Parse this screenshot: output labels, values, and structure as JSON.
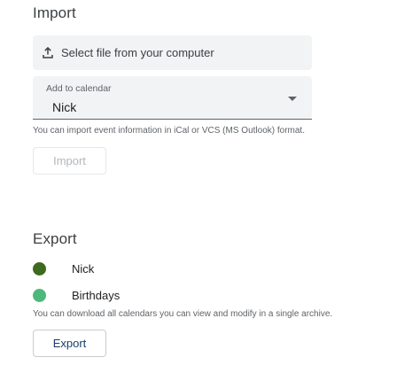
{
  "import": {
    "title": "Import",
    "select_file": {
      "label": "Select file from your computer",
      "icon": "upload-icon"
    },
    "calendar_select": {
      "caption": "Add to calendar",
      "value": "Nick",
      "icon": "dropdown-arrow-icon"
    },
    "help_text": "You can import event information in iCal or VCS (MS Outlook) format.",
    "button_label": "Import"
  },
  "export": {
    "title": "Export",
    "calendars": [
      {
        "name": "Nick",
        "color": "#3d6a1f"
      },
      {
        "name": "Birthdays",
        "color": "#4cb97b"
      }
    ],
    "help_text": "You can download all calendars you can view and modify in a single archive.",
    "button_label": "Export"
  },
  "colors": {
    "panel_background": "#f1f3f4",
    "text_primary": "#202124",
    "text_secondary": "#5f6368",
    "export_button_text": "#1a3d6d",
    "disabled_text": "#b3b6ba"
  }
}
